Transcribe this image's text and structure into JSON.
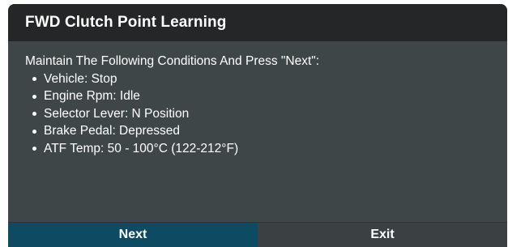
{
  "dialog": {
    "title": "FWD Clutch Point Learning",
    "instruction": "Maintain The Following Conditions And Press \"Next\":",
    "conditions": [
      "Vehicle: Stop",
      "Engine Rpm: Idle",
      "Selector Lever: N Position",
      "Brake Pedal: Depressed",
      "ATF Temp: 50 - 100°C (122-212°F)"
    ],
    "buttons": {
      "next_label": "Next",
      "exit_label": "Exit"
    }
  },
  "colors": {
    "titlebar_bg": "#252627",
    "body_bg": "#3f4647",
    "next_button_bg": "#0f4a63",
    "exit_button_bg": "#3b4142",
    "text": "#ffffff"
  }
}
